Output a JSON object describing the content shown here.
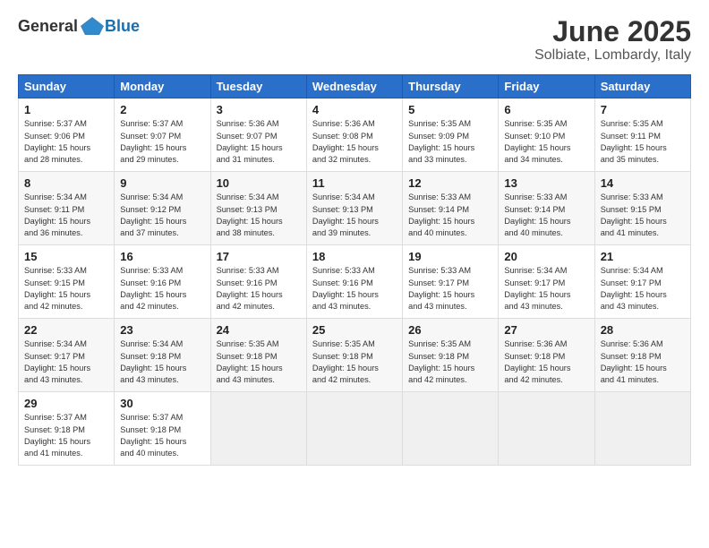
{
  "logo": {
    "general": "General",
    "blue": "Blue"
  },
  "header": {
    "month": "June 2025",
    "location": "Solbiate, Lombardy, Italy"
  },
  "weekdays": [
    "Sunday",
    "Monday",
    "Tuesday",
    "Wednesday",
    "Thursday",
    "Friday",
    "Saturday"
  ],
  "weeks": [
    [
      {
        "day": "1",
        "info": "Sunrise: 5:37 AM\nSunset: 9:06 PM\nDaylight: 15 hours\nand 28 minutes."
      },
      {
        "day": "2",
        "info": "Sunrise: 5:37 AM\nSunset: 9:07 PM\nDaylight: 15 hours\nand 29 minutes."
      },
      {
        "day": "3",
        "info": "Sunrise: 5:36 AM\nSunset: 9:07 PM\nDaylight: 15 hours\nand 31 minutes."
      },
      {
        "day": "4",
        "info": "Sunrise: 5:36 AM\nSunset: 9:08 PM\nDaylight: 15 hours\nand 32 minutes."
      },
      {
        "day": "5",
        "info": "Sunrise: 5:35 AM\nSunset: 9:09 PM\nDaylight: 15 hours\nand 33 minutes."
      },
      {
        "day": "6",
        "info": "Sunrise: 5:35 AM\nSunset: 9:10 PM\nDaylight: 15 hours\nand 34 minutes."
      },
      {
        "day": "7",
        "info": "Sunrise: 5:35 AM\nSunset: 9:11 PM\nDaylight: 15 hours\nand 35 minutes."
      }
    ],
    [
      {
        "day": "8",
        "info": "Sunrise: 5:34 AM\nSunset: 9:11 PM\nDaylight: 15 hours\nand 36 minutes."
      },
      {
        "day": "9",
        "info": "Sunrise: 5:34 AM\nSunset: 9:12 PM\nDaylight: 15 hours\nand 37 minutes."
      },
      {
        "day": "10",
        "info": "Sunrise: 5:34 AM\nSunset: 9:13 PM\nDaylight: 15 hours\nand 38 minutes."
      },
      {
        "day": "11",
        "info": "Sunrise: 5:34 AM\nSunset: 9:13 PM\nDaylight: 15 hours\nand 39 minutes."
      },
      {
        "day": "12",
        "info": "Sunrise: 5:33 AM\nSunset: 9:14 PM\nDaylight: 15 hours\nand 40 minutes."
      },
      {
        "day": "13",
        "info": "Sunrise: 5:33 AM\nSunset: 9:14 PM\nDaylight: 15 hours\nand 40 minutes."
      },
      {
        "day": "14",
        "info": "Sunrise: 5:33 AM\nSunset: 9:15 PM\nDaylight: 15 hours\nand 41 minutes."
      }
    ],
    [
      {
        "day": "15",
        "info": "Sunrise: 5:33 AM\nSunset: 9:15 PM\nDaylight: 15 hours\nand 42 minutes."
      },
      {
        "day": "16",
        "info": "Sunrise: 5:33 AM\nSunset: 9:16 PM\nDaylight: 15 hours\nand 42 minutes."
      },
      {
        "day": "17",
        "info": "Sunrise: 5:33 AM\nSunset: 9:16 PM\nDaylight: 15 hours\nand 42 minutes."
      },
      {
        "day": "18",
        "info": "Sunrise: 5:33 AM\nSunset: 9:16 PM\nDaylight: 15 hours\nand 43 minutes."
      },
      {
        "day": "19",
        "info": "Sunrise: 5:33 AM\nSunset: 9:17 PM\nDaylight: 15 hours\nand 43 minutes."
      },
      {
        "day": "20",
        "info": "Sunrise: 5:34 AM\nSunset: 9:17 PM\nDaylight: 15 hours\nand 43 minutes."
      },
      {
        "day": "21",
        "info": "Sunrise: 5:34 AM\nSunset: 9:17 PM\nDaylight: 15 hours\nand 43 minutes."
      }
    ],
    [
      {
        "day": "22",
        "info": "Sunrise: 5:34 AM\nSunset: 9:17 PM\nDaylight: 15 hours\nand 43 minutes."
      },
      {
        "day": "23",
        "info": "Sunrise: 5:34 AM\nSunset: 9:18 PM\nDaylight: 15 hours\nand 43 minutes."
      },
      {
        "day": "24",
        "info": "Sunrise: 5:35 AM\nSunset: 9:18 PM\nDaylight: 15 hours\nand 43 minutes."
      },
      {
        "day": "25",
        "info": "Sunrise: 5:35 AM\nSunset: 9:18 PM\nDaylight: 15 hours\nand 42 minutes."
      },
      {
        "day": "26",
        "info": "Sunrise: 5:35 AM\nSunset: 9:18 PM\nDaylight: 15 hours\nand 42 minutes."
      },
      {
        "day": "27",
        "info": "Sunrise: 5:36 AM\nSunset: 9:18 PM\nDaylight: 15 hours\nand 42 minutes."
      },
      {
        "day": "28",
        "info": "Sunrise: 5:36 AM\nSunset: 9:18 PM\nDaylight: 15 hours\nand 41 minutes."
      }
    ],
    [
      {
        "day": "29",
        "info": "Sunrise: 5:37 AM\nSunset: 9:18 PM\nDaylight: 15 hours\nand 41 minutes."
      },
      {
        "day": "30",
        "info": "Sunrise: 5:37 AM\nSunset: 9:18 PM\nDaylight: 15 hours\nand 40 minutes."
      },
      {
        "day": "",
        "info": ""
      },
      {
        "day": "",
        "info": ""
      },
      {
        "day": "",
        "info": ""
      },
      {
        "day": "",
        "info": ""
      },
      {
        "day": "",
        "info": ""
      }
    ]
  ]
}
